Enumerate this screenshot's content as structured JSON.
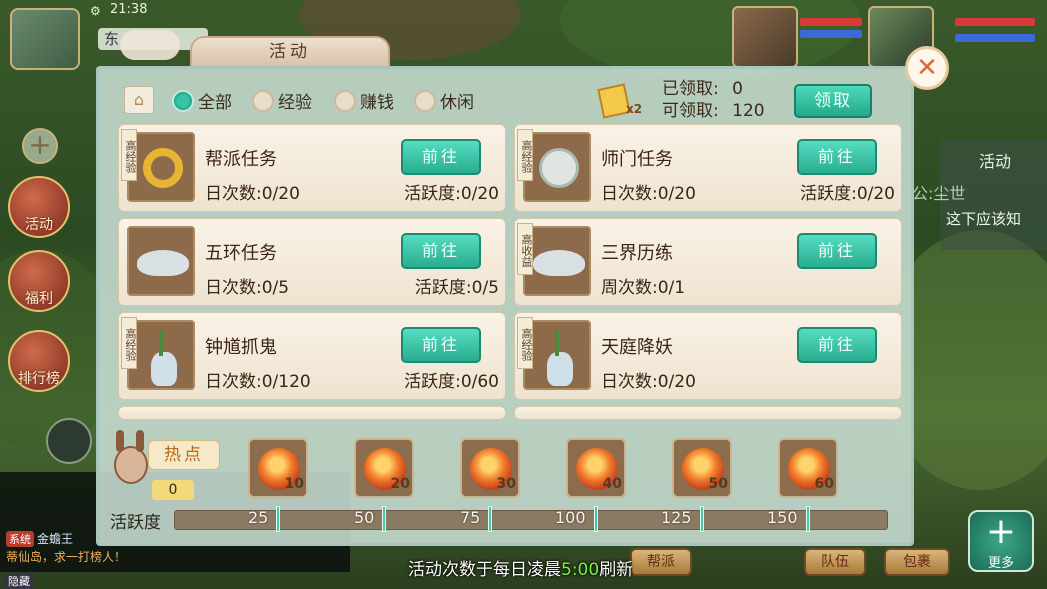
{
  "hud": {
    "clock": "21:38",
    "location_label": "东",
    "left_buttons": [
      {
        "label": "活动",
        "icon": "megaphone-icon"
      },
      {
        "label": "福利",
        "icon": "gift-icon"
      },
      {
        "label": "排行榜",
        "icon": "ranking-icon"
      }
    ],
    "chat": {
      "system_tag": "系统",
      "line1": "金蟾王",
      "line2": "蒂仙岛，求一打榜人！",
      "hide_label": "隐藏"
    },
    "right_panel": {
      "tab": "活动",
      "line1": "公:尘世",
      "line2": "这下应该知"
    },
    "bottom_buttons": [
      "帮派",
      "队伍",
      "包裹",
      "更多"
    ]
  },
  "dialog": {
    "title": "活动",
    "close_icon": "close-icon",
    "filters": [
      {
        "label": "全部",
        "selected": true
      },
      {
        "label": "经验",
        "selected": false
      },
      {
        "label": "赚钱",
        "selected": false
      },
      {
        "label": "休闲",
        "selected": false
      }
    ],
    "claimed_label": "已领取:",
    "claimed_value": "0",
    "available_label": "可领取:",
    "available_value": "120",
    "claim_button": "领取",
    "reward_multiplier": "x2",
    "cards": [
      {
        "name": "帮派任务",
        "tag": "高经验",
        "count": "日次数:0/20",
        "activity": "活跃度:0/20",
        "button": "前往",
        "icon": "coin-ring-icon"
      },
      {
        "name": "师门任务",
        "tag": "高经验",
        "count": "日次数:0/20",
        "activity": "活跃度:0/20",
        "button": "前往",
        "icon": "jade-coin-icon"
      },
      {
        "name": "五环任务",
        "tag": "",
        "count": "日次数:0/5",
        "activity": "活跃度:0/5",
        "button": "前往",
        "icon": "silver-ingot-icon"
      },
      {
        "name": "三界历练",
        "tag": "高收益",
        "count": "周次数:0/1",
        "activity": "",
        "button": "前往",
        "icon": "silver-ingot-icon"
      },
      {
        "name": "钟馗抓鬼",
        "tag": "高经验",
        "count": "日次数:0/120",
        "activity": "活跃度:0/60",
        "button": "前往",
        "icon": "vase-icon"
      },
      {
        "name": "天庭降妖",
        "tag": "高经验",
        "count": "日次数:0/20",
        "activity": "",
        "button": "前往",
        "icon": "vase-icon"
      }
    ],
    "hot_label": "热点",
    "hot_value": "0",
    "chests": [
      "10",
      "20",
      "30",
      "40",
      "50",
      "60"
    ],
    "activity_label": "活跃度",
    "progress_value": 0,
    "milestones": [
      "25",
      "50",
      "75",
      "100",
      "125",
      "150"
    ],
    "refresh_prefix": "活动次数于每日凌晨",
    "refresh_time": "5:00",
    "refresh_suffix": "刷新"
  },
  "colors": {
    "accent_teal": "#28ad90",
    "card_bg": "#f9f2e6",
    "progress_bg": "#8b7a63",
    "highlight_green": "#7cf04a"
  }
}
